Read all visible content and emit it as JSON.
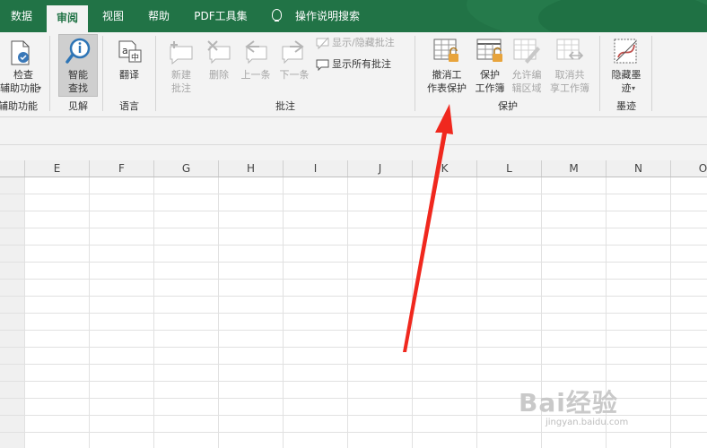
{
  "tabs": [
    {
      "label": "数据"
    },
    {
      "label": "审阅"
    },
    {
      "label": "视图"
    },
    {
      "label": "帮助"
    },
    {
      "label": "PDF工具集"
    },
    {
      "label": "操作说明搜索"
    }
  ],
  "ribbon": {
    "accessibility": {
      "line1": "检查",
      "line2": "辅助功能",
      "group": "辅助功能"
    },
    "insights": {
      "line1": "智能",
      "line2": "查找",
      "group": "见解"
    },
    "language": {
      "line1": "翻译",
      "group": "语言"
    },
    "comments": {
      "new": {
        "line1": "新建",
        "line2": "批注"
      },
      "delete": "删除",
      "prev": "上一条",
      "next": "下一条",
      "show_hide": "显示/隐藏批注",
      "show_all": "显示所有批注",
      "group": "批注"
    },
    "protect": {
      "unprotect_sheet": {
        "line1": "撤消工",
        "line2": "作表保护"
      },
      "protect_workbook": {
        "line1": "保护",
        "line2": "工作簿"
      },
      "allow_edit": {
        "line1": "允许编",
        "line2": "辑区域"
      },
      "unshare": {
        "line1": "取消共",
        "line2": "享工作簿"
      },
      "group": "保护"
    },
    "ink": {
      "line1": "隐藏墨",
      "line2": "迹",
      "group": "墨迹"
    }
  },
  "columns": [
    "E",
    "F",
    "G",
    "H",
    "I",
    "J",
    "K",
    "L",
    "M",
    "N",
    "O"
  ],
  "watermark": {
    "main": "Bai经验",
    "url": "jingyan.baidu.com"
  },
  "colors": {
    "tabbar": "#217346",
    "ribbon": "#f3f3f3",
    "arrow": "#f0281e"
  }
}
